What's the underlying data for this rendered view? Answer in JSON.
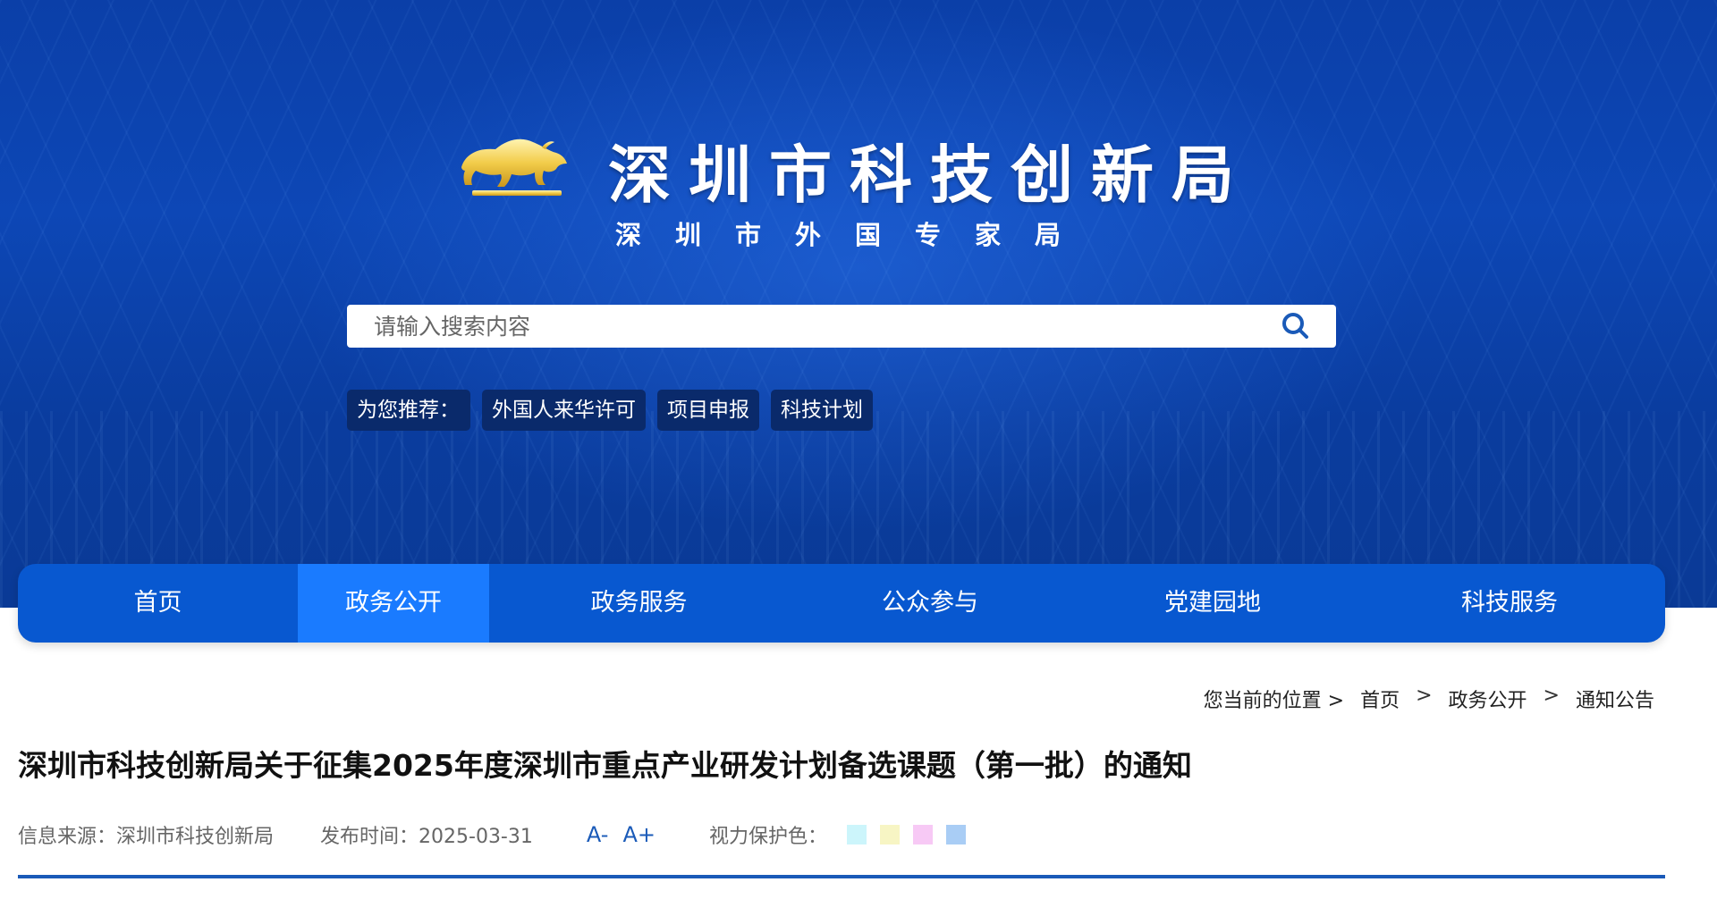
{
  "header": {
    "site_title": "深圳市科技创新局",
    "site_subtitle": "深圳市外国专家局"
  },
  "search": {
    "placeholder": "请输入搜索内容",
    "icon": "search-icon"
  },
  "recommend": {
    "label": "为您推荐：",
    "tags": [
      "外国人来华许可",
      "项目申报",
      "科技计划"
    ]
  },
  "nav": {
    "items": [
      {
        "label": "首页"
      },
      {
        "label": "政务公开"
      },
      {
        "label": "政务服务"
      },
      {
        "label": "公众参与"
      },
      {
        "label": "党建园地"
      },
      {
        "label": "科技服务"
      }
    ],
    "active_index": 1
  },
  "breadcrumb": {
    "prefix": "您当前的位置 >",
    "items": [
      "首页",
      "政务公开",
      "通知公告"
    ],
    "separator": ">"
  },
  "article": {
    "title": "深圳市科技创新局关于征集2025年度深圳市重点产业研发计划备选课题（第一批）的通知",
    "source": "信息来源：深圳市科技创新局",
    "date": "发布时间：2025-03-31",
    "font_smaller": "A-",
    "font_larger": "A+",
    "eye_protection_label": "视力保护色：",
    "eye_colors": [
      "#ccf5fb",
      "#f7f5c4",
      "#f7c9f5",
      "#a9cdf5"
    ]
  },
  "colors": {
    "nav_bg": "#0858d0",
    "nav_active": "#1a7bff",
    "accent": "#1a5ab8",
    "banner": "#0d47b6"
  }
}
